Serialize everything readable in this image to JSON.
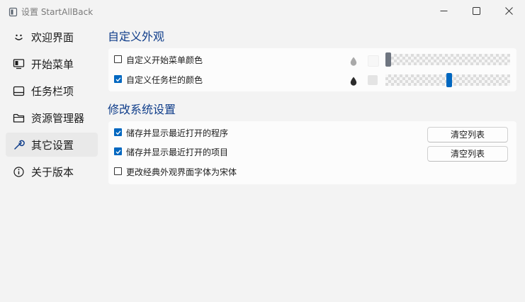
{
  "window": {
    "title": "设置 StartAllBack",
    "app_icon": "startallback-app-icon",
    "controls": [
      "minimize-icon",
      "maximize-icon",
      "close-icon"
    ]
  },
  "sidebar": {
    "items": [
      {
        "label": "欢迎界面",
        "icon": "smiley-icon",
        "selected": false
      },
      {
        "label": "开始菜单",
        "icon": "start-menu-icon",
        "selected": false
      },
      {
        "label": "任务栏项",
        "icon": "taskbar-icon",
        "selected": false
      },
      {
        "label": "资源管理器",
        "icon": "folder-icon",
        "selected": false
      },
      {
        "label": "其它设置",
        "icon": "wrench-icon",
        "selected": true
      },
      {
        "label": "关于版本",
        "icon": "info-icon",
        "selected": false
      }
    ]
  },
  "appearance": {
    "title": "自定义外观",
    "rows": [
      {
        "label": "自定义开始菜单颜色",
        "checked": false,
        "icon": "color-drop-icon",
        "slider_value": 0.0
      },
      {
        "label": "自定义任务栏的颜色",
        "checked": true,
        "icon": "color-drop-icon",
        "slider_value": 0.51
      }
    ]
  },
  "system": {
    "title": "修改系统设置",
    "rows": [
      {
        "label": "储存并显示最近打开的程序",
        "checked": true,
        "button": "清空列表"
      },
      {
        "label": "储存并显示最近打开的项目",
        "checked": true,
        "button": "清空列表"
      },
      {
        "label": "更改经典外观界面字体为宋体",
        "checked": false
      }
    ]
  },
  "colors": {
    "accent": "#0067c0",
    "section_title": "#0f3d8a",
    "thumb_disabled": "#6e7580"
  }
}
